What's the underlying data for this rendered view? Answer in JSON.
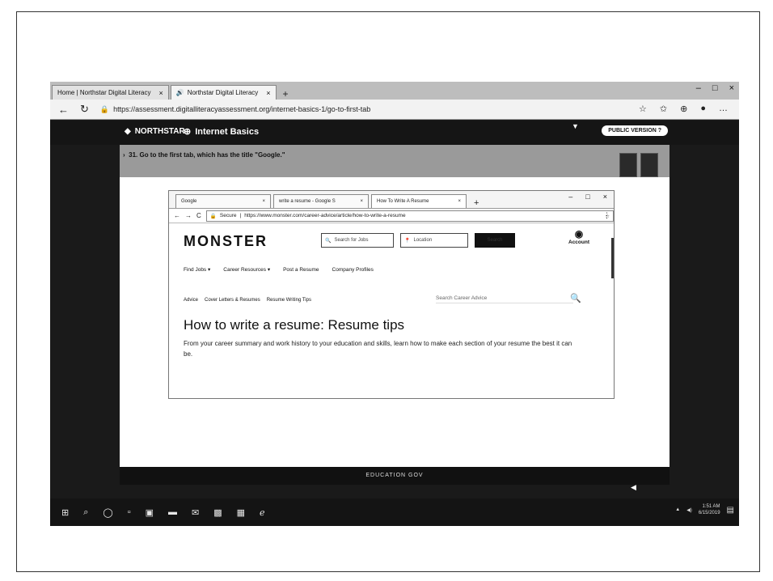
{
  "outer_browser": {
    "tabs": [
      {
        "label": "Home | Northstar Digital Literacy",
        "active": false
      },
      {
        "label": "Northstar Digital Literacy",
        "active": true
      }
    ],
    "new_tab": "+",
    "url": "https://assessment.digitalliteracyassessment.org/internet-basics-1/go-to-first-tab"
  },
  "northstar": {
    "logo": "NORTHSTAR",
    "section": "Internet Basics",
    "public_version": "PUBLIC VERSION",
    "task": "31. Go to the first tab, which has the title \"Google.\""
  },
  "inner_browser": {
    "tabs": [
      {
        "label": "Google",
        "active": false
      },
      {
        "label": "write a resume - Google S",
        "active": false
      },
      {
        "label": "How To Write A Resume",
        "active": true
      }
    ],
    "secure_label": "Secure",
    "url": "https://www.monster.com/career-advice/article/how-to-write-a-resume"
  },
  "monster": {
    "logo": "MONSTER",
    "search_jobs_placeholder": "Search for Jobs",
    "location_placeholder": "Location",
    "search_button": "Search",
    "account": "Account",
    "nav": [
      "Find Jobs",
      "Career Resources",
      "Post a Resume",
      "Company Profiles"
    ],
    "subnav": [
      "Advice",
      "Cover Letters & Resumes",
      "Resume Writing Tips"
    ],
    "advice_search_placeholder": "Search Career Advice",
    "title": "How to write a resume: Resume tips",
    "lead": "From your career summary and work history to your education and skills, learn how to make each section of your resume the best it can be."
  },
  "status_strip": "EDUCATION GOV",
  "taskbar": {
    "clock_time": "1:51 AM",
    "clock_date": "6/15/2019"
  }
}
